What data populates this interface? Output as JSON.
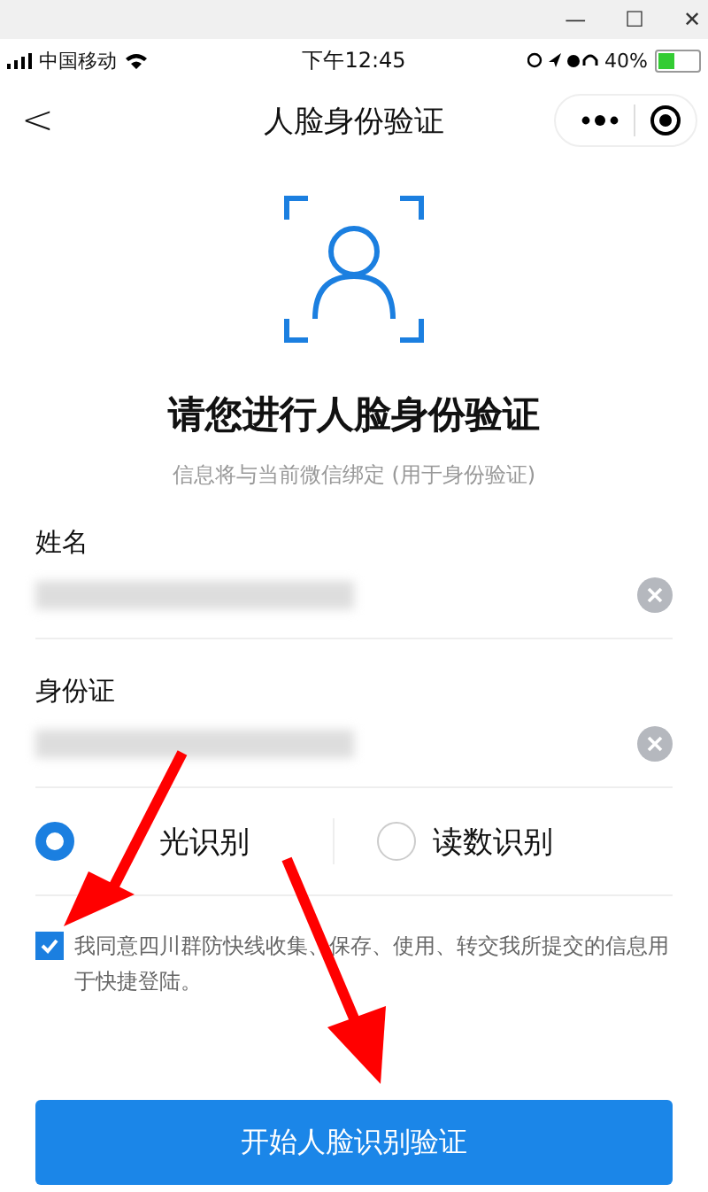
{
  "window": {
    "controls": [
      "—",
      "☐",
      "✕"
    ]
  },
  "status_bar": {
    "carrier": "中国移动",
    "time": "下午12:45",
    "battery": "40%"
  },
  "nav": {
    "back": "<",
    "title": "人脸身份验证"
  },
  "header": {
    "title": "请您进行人脸身份验证",
    "subtitle": "信息将与当前微信绑定 (用于身份验证)"
  },
  "fields": [
    {
      "label": "姓名"
    },
    {
      "label": "身份证"
    }
  ],
  "modes": [
    {
      "label": "光识别",
      "selected": true
    },
    {
      "label": "读数识别",
      "selected": false
    }
  ],
  "agreement": {
    "checked": true,
    "text": "我同意四川群防快线收集、保存、使用、转交我所提交的信息用于快捷登陆。"
  },
  "submit": "开始人脸识别验证"
}
